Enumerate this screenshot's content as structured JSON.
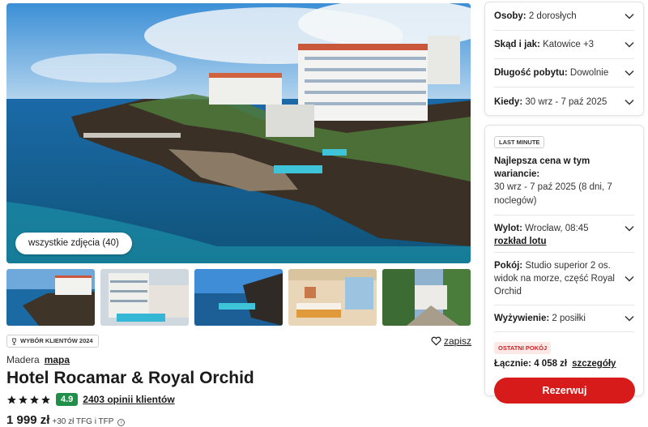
{
  "gallery": {
    "all_photos_label": "wszystkie zdjęcia (40)"
  },
  "badge": {
    "label": "WYBÓR KLIENTÓW 2024",
    "icon": "trophy-icon"
  },
  "save": {
    "label": "zapisz",
    "icon": "heart-icon"
  },
  "location": {
    "region": "Madera",
    "map_link": "mapa"
  },
  "hotel": {
    "name": "Hotel Rocamar & Royal Orchid",
    "stars": 4,
    "score": "4.9",
    "reviews_link": "2403 opinii klientów"
  },
  "price": {
    "amount": "1 999 zł",
    "extra": "+30 zł TFG i TFP",
    "info_icon": "info-icon"
  },
  "filters": {
    "persons": {
      "label": "Osoby:",
      "value": "2 dorosłych"
    },
    "departure": {
      "label": "Skąd i jak:",
      "value": "Katowice +3"
    },
    "duration": {
      "label": "Długość pobytu:",
      "value": "Dowolnie"
    },
    "when": {
      "label": "Kiedy:",
      "value": "30 wrz - 7 paź 2025"
    }
  },
  "offer": {
    "tag": "LAST MINUTE",
    "best_price_title": "Najlepsza cena w tym wariancie:",
    "best_price_dates": "30 wrz - 7 paź 2025 (8 dni, 7 noclegów)",
    "flight": {
      "label": "Wylot:",
      "value": "Wrocław, 08:45",
      "link": "rozkład lotu"
    },
    "room": {
      "label": "Pokój:",
      "value": "Studio superior 2 os. widok na morze, część Royal Orchid"
    },
    "board": {
      "label": "Wyżywienie:",
      "value": "2 posiłki"
    },
    "last_room_badge": "OSTATNI POKÓJ",
    "total": {
      "label": "Łącznie: 4 058 zł",
      "details_link": "szczegóły"
    },
    "book_button": "Rezerwuj"
  },
  "colors": {
    "accent": "#d71b1b",
    "score_bg": "#1f8f4a",
    "last_room_text": "#c62828"
  }
}
